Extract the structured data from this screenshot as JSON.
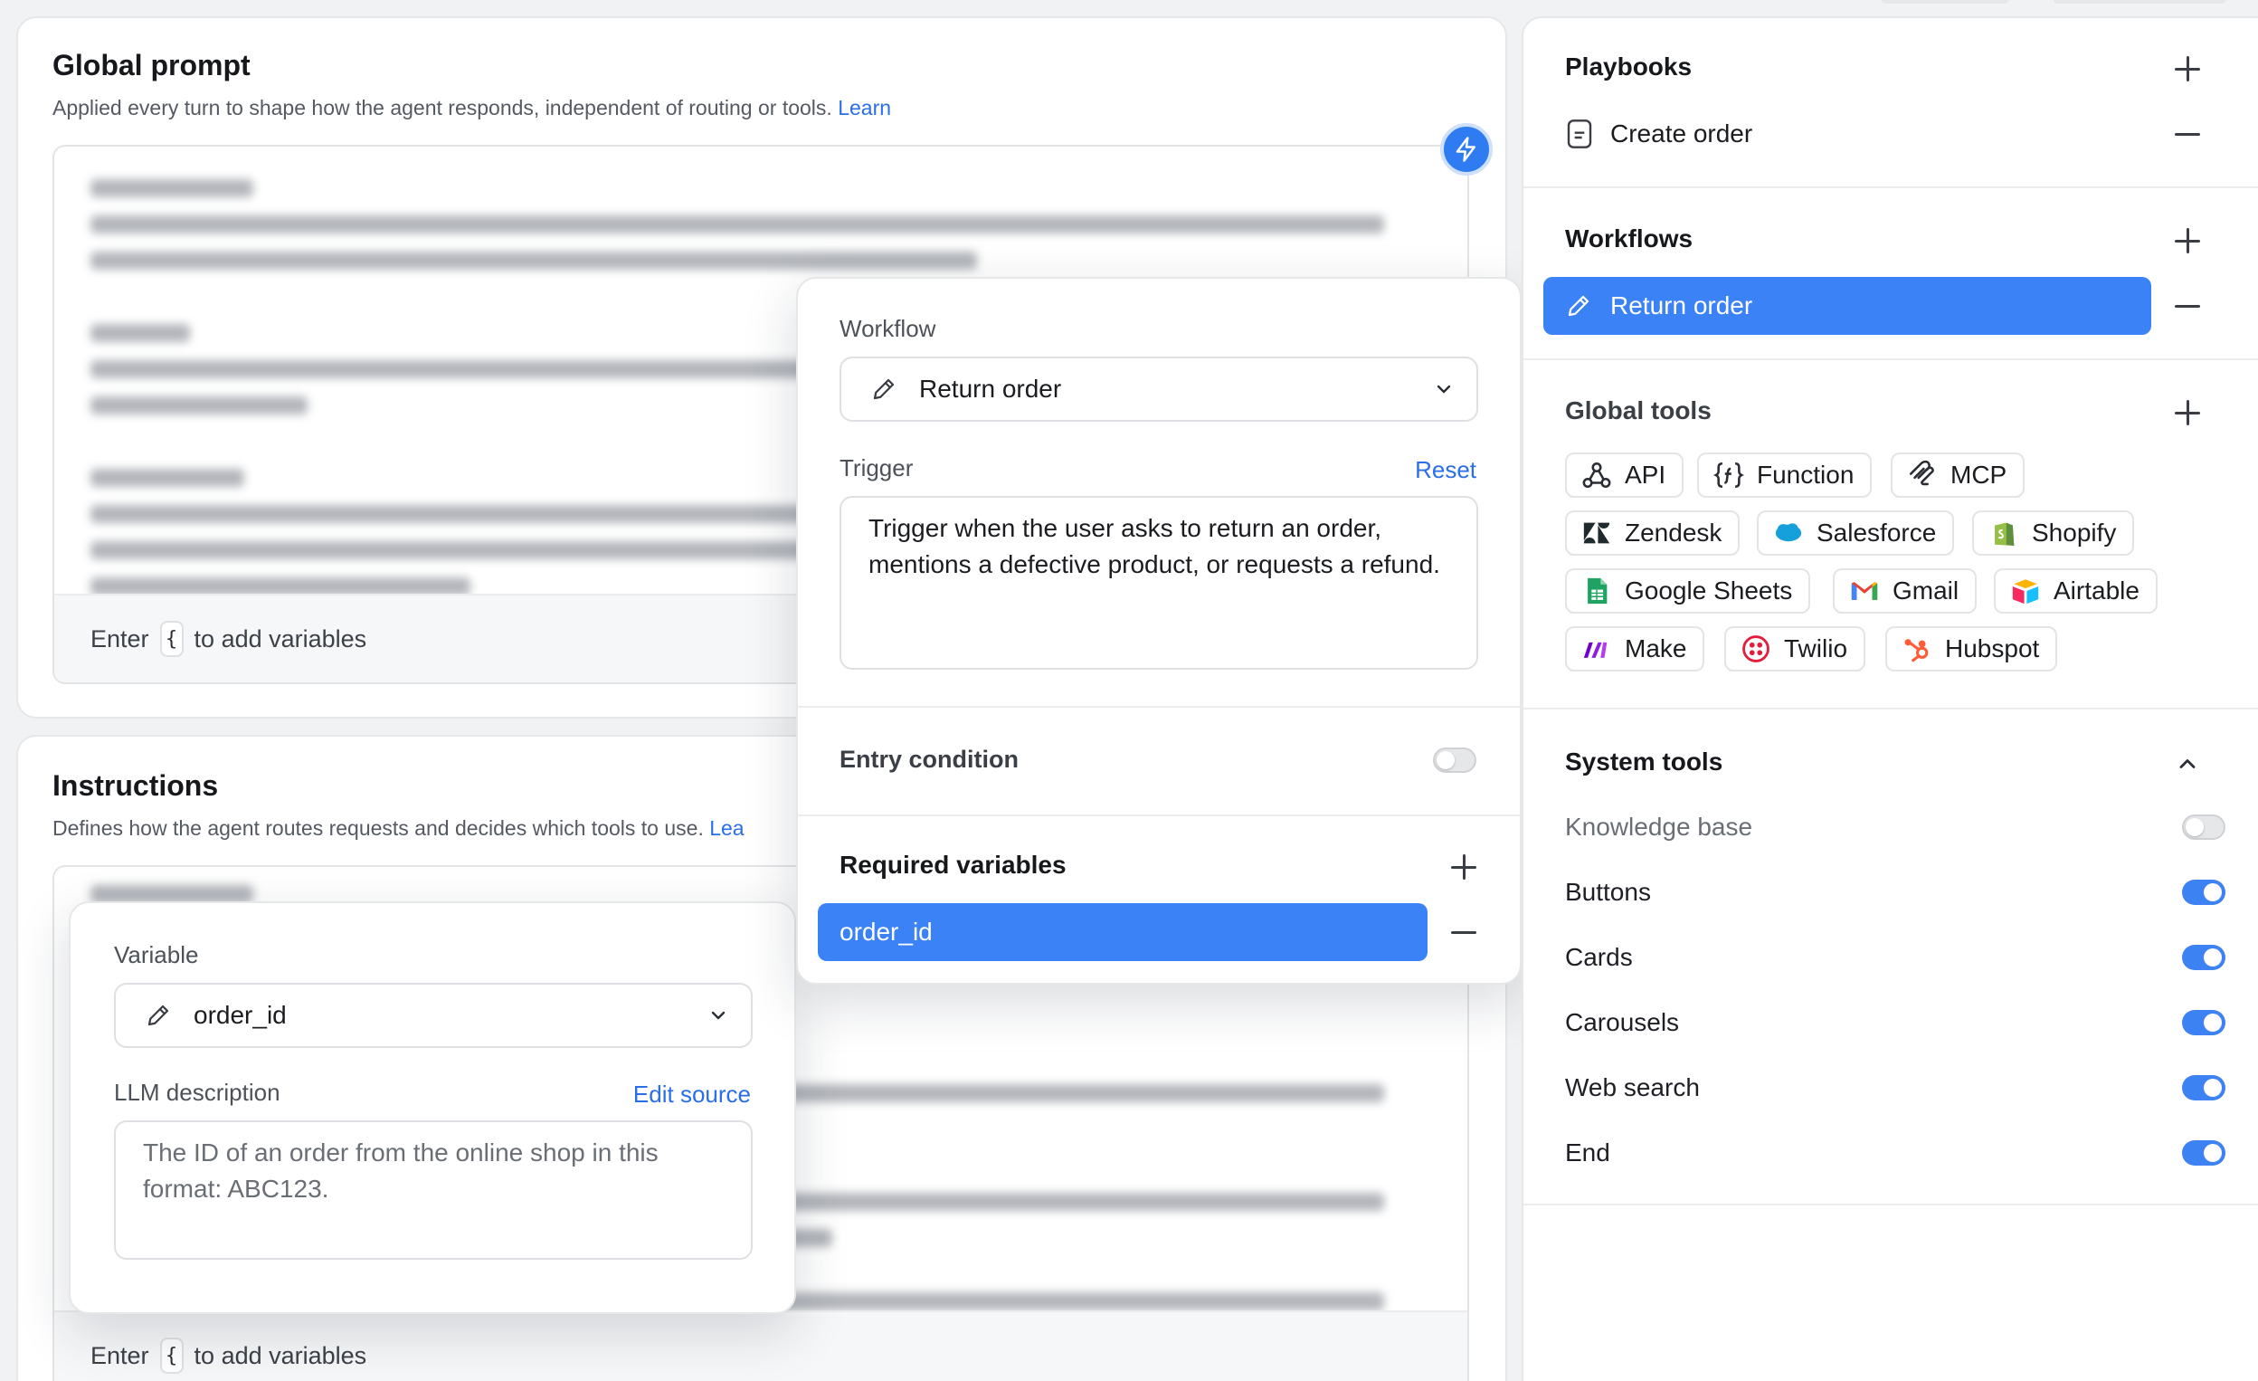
{
  "global_prompt": {
    "title": "Global prompt",
    "subtitle": "Applied every turn to shape how the agent responds, independent of routing or tools.",
    "learn_link": "Learn",
    "footer_pre": "Enter",
    "footer_key": "{",
    "footer_post": "to add variables"
  },
  "instructions": {
    "title": "Instructions",
    "subtitle": "Defines how the agent routes requests and decides which tools to use.",
    "learn_link": "Lea",
    "footer_pre": "Enter",
    "footer_key": "{",
    "footer_post": "to add variables"
  },
  "workflow_popup": {
    "workflow_label": "Workflow",
    "workflow_value": "Return order",
    "trigger_label": "Trigger",
    "reset_label": "Reset",
    "trigger_text": "Trigger when the user asks to return an order, mentions a defective product, or requests a refund.",
    "entry_condition_label": "Entry condition",
    "entry_condition_on": false,
    "required_variables_label": "Required variables",
    "required_variables": [
      "order_id"
    ]
  },
  "variable_popup": {
    "variable_label": "Variable",
    "variable_value": "order_id",
    "description_label": "LLM description",
    "edit_source_label": "Edit source",
    "description_text": "The ID of an order from the online shop in this format: ABC123."
  },
  "sidebar": {
    "playbooks": {
      "title": "Playbooks",
      "items": [
        "Create order"
      ]
    },
    "workflows": {
      "title": "Workflows",
      "items": [
        "Return order"
      ]
    },
    "global_tools": {
      "title": "Global tools",
      "tools": [
        "API",
        "Function",
        "MCP",
        "Zendesk",
        "Salesforce",
        "Shopify",
        "Google Sheets",
        "Gmail",
        "Airtable",
        "Make",
        "Twilio",
        "Hubspot"
      ]
    },
    "system_tools": {
      "title": "System tools",
      "items": [
        {
          "label": "Knowledge base",
          "enabled": false
        },
        {
          "label": "Buttons",
          "enabled": true
        },
        {
          "label": "Cards",
          "enabled": true
        },
        {
          "label": "Carousels",
          "enabled": true
        },
        {
          "label": "Web search",
          "enabled": true
        },
        {
          "label": "End",
          "enabled": true
        }
      ]
    }
  },
  "colors": {
    "accent": "#2f7bf1",
    "selected_bg": "#3b82f6",
    "link": "#2a6ee8"
  }
}
